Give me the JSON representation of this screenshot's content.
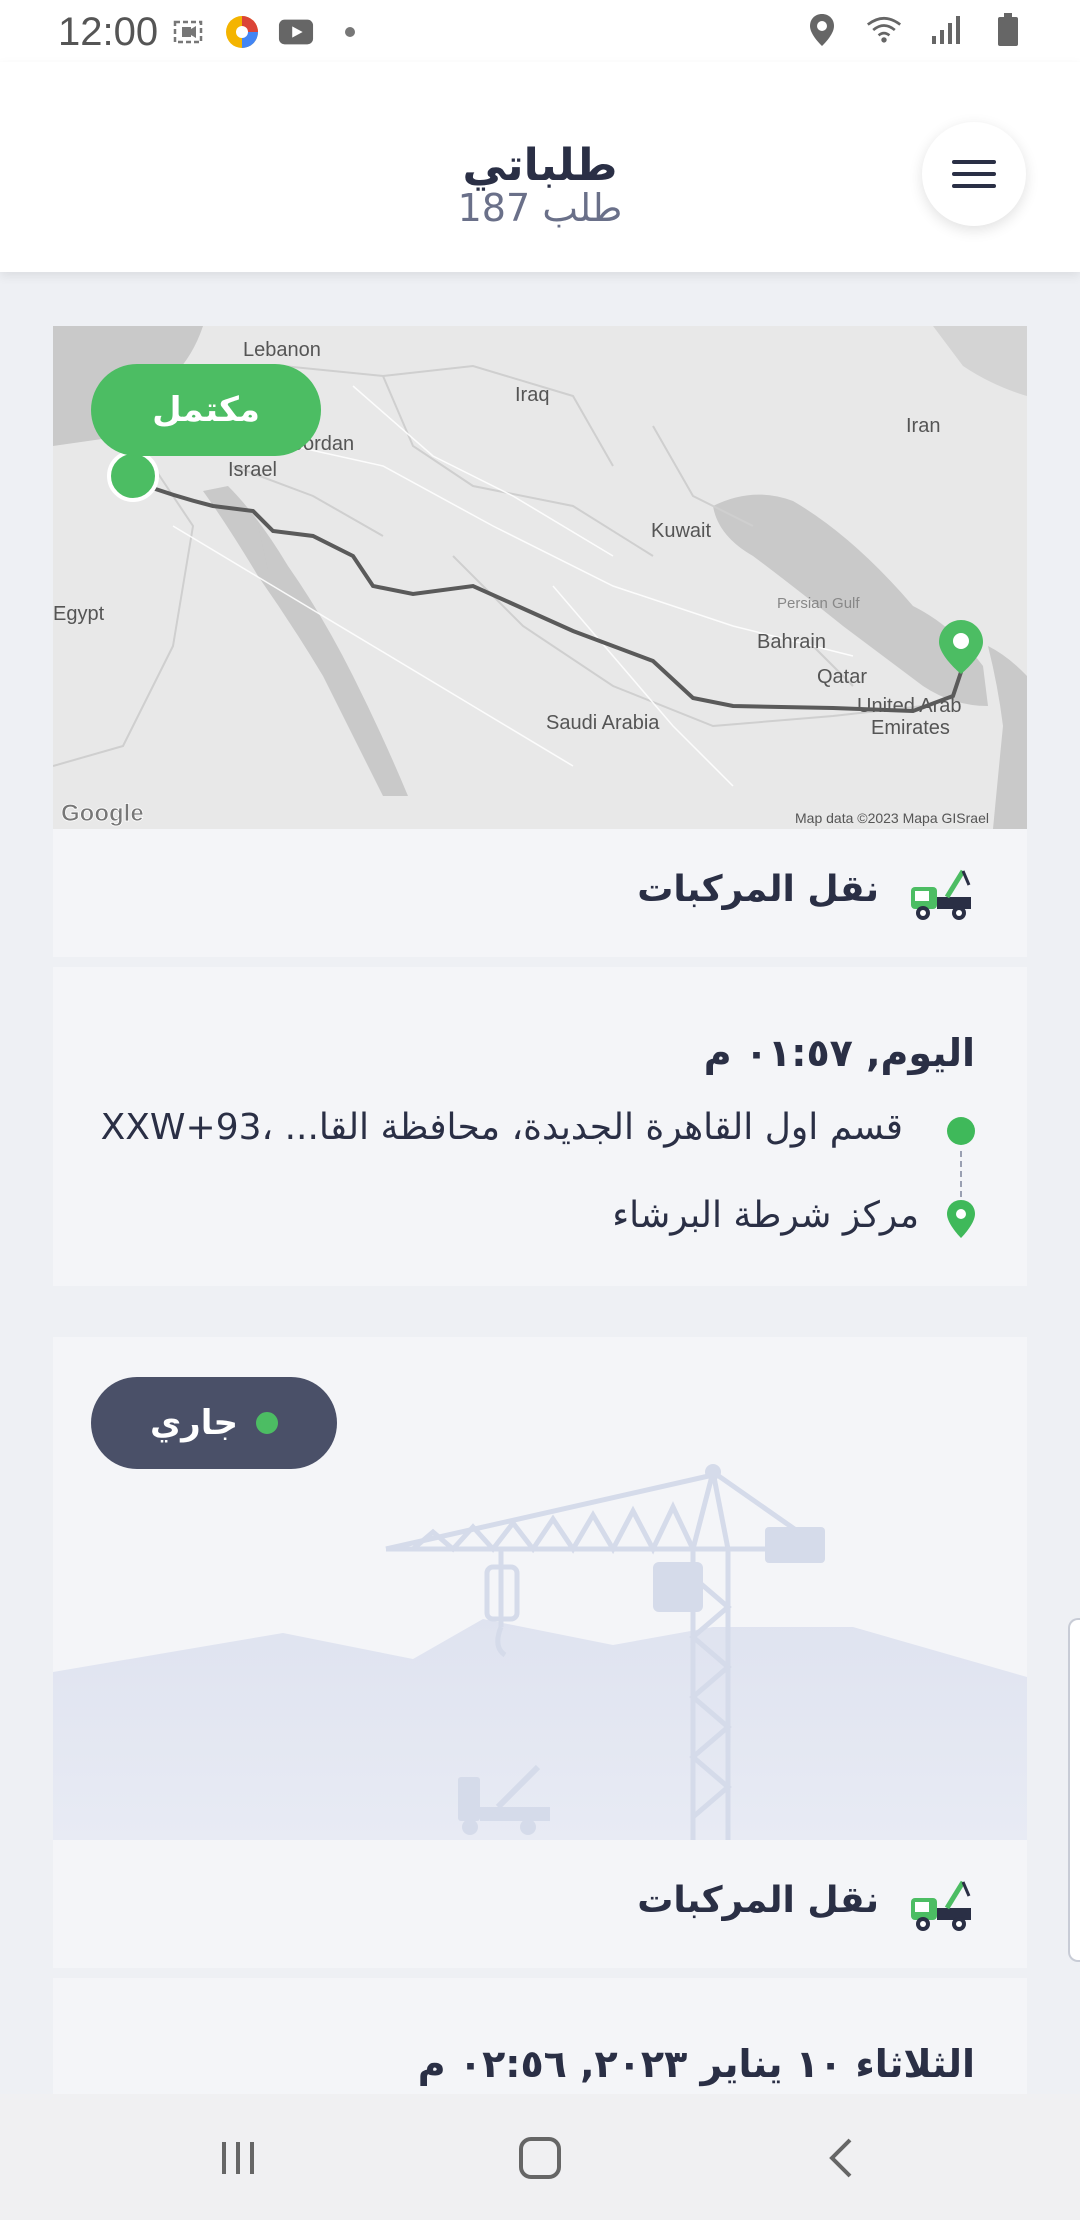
{
  "status_bar": {
    "time": "12:00",
    "left_icons": [
      "screen-record-icon",
      "photos-app-icon",
      "youtube-icon",
      "dot-icon"
    ],
    "right_icons": [
      "location-icon",
      "wifi-icon",
      "signal-icon",
      "battery-icon"
    ]
  },
  "header": {
    "title": "طلباتي",
    "subtitle": "187 طلب"
  },
  "orders": [
    {
      "status": "مكتمل",
      "status_color": "#4cbd63",
      "map": {
        "labels": {
          "lebanon": "Lebanon",
          "iraq": "Iraq",
          "iran": "Iran",
          "jordan": "Jordan",
          "israel": "Israel",
          "kuwait": "Kuwait",
          "egypt": "Egypt",
          "persian_gulf": "Persian Gulf",
          "bahrain": "Bahrain",
          "qatar": "Qatar",
          "uae_line1": "United Arab",
          "uae_line2": "Emirates",
          "saudi_arabia": "Saudi Arabia"
        },
        "attribution": "Map data ©2023 Mapa GISrael",
        "logo": "Google"
      },
      "service": "نقل المركبات",
      "date": "اليوم, ٠١:٥٧ م",
      "from": "قسم اول القاهرة الجديدة، محافظة القا... ،93+XXW",
      "to": "مركز شرطة البرشاء"
    },
    {
      "status": "جاري",
      "status_color": "#4a5068",
      "service": "نقل المركبات",
      "date": "الثلاثاء ١٠ يناير ٢٠٢٣, ٠٢:٥٦ م"
    }
  ],
  "navbar": {
    "icons": [
      "recent-apps-icon",
      "home-icon",
      "back-icon"
    ]
  },
  "colors": {
    "accent_green": "#4cbd63",
    "dark_slate": "#4a5068",
    "text": "#2a2f45"
  }
}
